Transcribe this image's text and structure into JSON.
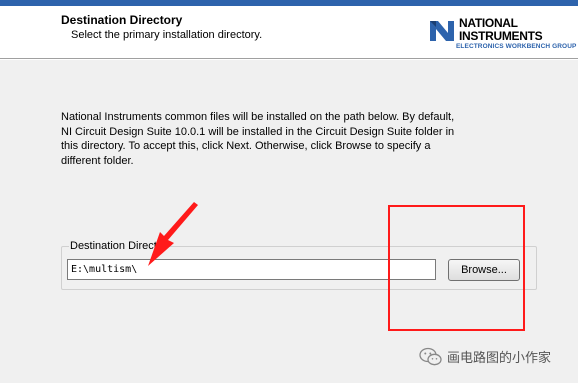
{
  "header": {
    "title": "Destination Directory",
    "subtitle": "Select the primary installation directory."
  },
  "logo": {
    "line1": "NATIONAL",
    "line2": "INSTRUMENTS",
    "tagline": "ELECTRONICS WORKBENCH GROUP",
    "brand_color": "#2d63ac"
  },
  "body": {
    "description": "National Instruments common files will be installed on the path below. By default, NI Circuit Design Suite 10.0.1 will be installed in the Circuit Design Suite folder in this directory. To accept this, click Next. Otherwise, click Browse to specify a different folder."
  },
  "destination": {
    "group_label": "Destination Directory",
    "path_value": "E:\\multism\\",
    "browse_label": "Browse..."
  },
  "annotations": {
    "arrow_color": "#ff1a1a",
    "highlight_box_color": "#ff1a1a"
  },
  "watermark": {
    "text": "画电路图的小作家",
    "icon": "wechat-icon"
  }
}
